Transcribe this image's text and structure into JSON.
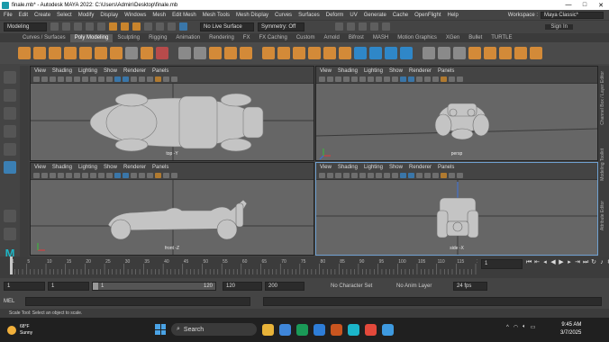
{
  "window": {
    "title": "finale.mb* - Autodesk MAYA 2022: C:\\Users\\Admin\\Desktop\\finale.mb",
    "controls": [
      "—",
      "□",
      "✕"
    ]
  },
  "menubar": {
    "items": [
      "File",
      "Edit",
      "Create",
      "Select",
      "Modify",
      "Display",
      "Windows",
      "Mesh",
      "Edit Mesh",
      "Mesh Tools",
      "Mesh Display",
      "Curves",
      "Surfaces",
      "Deform",
      "UV",
      "Generate",
      "Cache",
      "OpenFlight",
      "Help"
    ],
    "workspace_label": "Workspace :",
    "workspace_value": "Maya Classic*"
  },
  "statusline": {
    "mode": "Modeling",
    "live_surface": "No Live Surface",
    "symmetry": "Symmetry: Off",
    "sign_in": "Sign In"
  },
  "shelf_tabs": [
    "Curves / Surfaces",
    "Poly Modeling",
    "Sculpting",
    "Rigging",
    "Animation",
    "Rendering",
    "FX",
    "FX Caching",
    "Custom",
    "Arnold",
    "Bifrost",
    "MASH",
    "Motion Graphics",
    "XGen",
    "Bullet",
    "TURTLE"
  ],
  "shelf_active": "Poly Modeling",
  "viewport_menu": [
    "View",
    "Shading",
    "Lighting",
    "Show",
    "Renderer",
    "Panels"
  ],
  "viewports": {
    "top": "top -Y",
    "persp": "persp",
    "front": "front -Z",
    "side": "side -X"
  },
  "sidebar_right": {
    "channel": "Channel Box / Layer Editor",
    "modeling": "Modeling Toolkit",
    "attr": "Attribute Editor"
  },
  "timeslider": {
    "ticks": [
      "1",
      "5",
      "10",
      "15",
      "20",
      "25",
      "30",
      "35",
      "40",
      "45",
      "50",
      "55",
      "60",
      "65",
      "70",
      "75",
      "80",
      "85",
      "90",
      "95",
      "100",
      "105",
      "110",
      "115",
      "120"
    ],
    "current_frame": "1"
  },
  "rangeslider": {
    "start": "1",
    "inner_start": "1",
    "range_start": "1",
    "range_end": "120",
    "end": "120",
    "anim_end": "200",
    "character_set": "No Character Set",
    "anim_layer": "No Anim Layer",
    "fps": "24 fps"
  },
  "cmdline": {
    "label": "MEL"
  },
  "helpline": {
    "text": "Scale Tool: Select an object to scale."
  },
  "taskbar": {
    "temp": "68°F",
    "weather": "Sunny",
    "search": "Search",
    "time": "9:45 AM",
    "date": "3/7/2025",
    "tray_chevron": "^",
    "app_colors": [
      "#e8b339",
      "#3f86d9",
      "#1a9a57",
      "#2e7dd7",
      "#c9551f",
      "#1bb5c9",
      "#e3493b",
      "#3e9ae0",
      "#16a085",
      "#d4d4d4"
    ]
  }
}
